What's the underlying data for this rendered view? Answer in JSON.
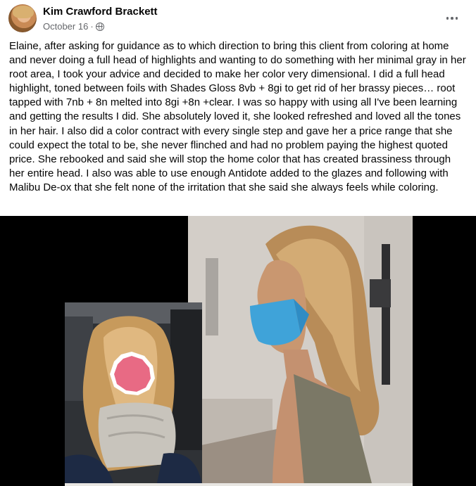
{
  "post": {
    "author": "Kim Crawford Brackett",
    "date": "October 16",
    "separator": "·",
    "privacy_icon": "globe-icon",
    "menu_icon": "more-options-icon",
    "text": "Elaine, after asking for guidance as to which direction to bring this client from coloring at home and never doing a full head of highlights and wanting to do something with her minimal gray in her root area, I took your advice and decided to make her color very dimensional. I did a full head highlight, toned between foils with Shades Gloss 8vb + 8gi to get rid of her brassy pieces… root tapped with 7nb + 8n melted into 8gi +8n +clear. I was so happy with using all I've been learning and getting the results I did. She absolutely loved it, she looked refreshed and loved all the tones in her hair. I also did a color contract with every single step and gave her a price range that she could expect the total to be, she never flinched and had no problem paying the highest quoted price. She rebooked and said she will stop the home color that has created brassiness through her entire head. I also was able to use enough Antidote added to the glazes and following with Malibu De-ox that she felt none of the irritation that she said she always feels while coloring."
  },
  "photo": {
    "left_image": "before-photo-client-in-car-with-blurred-face",
    "right_image": "after-photo-client-profile-with-blue-mask"
  },
  "colors": {
    "text": "#050505",
    "secondary_text": "#65676b",
    "mask_blue": "#3fa3d9",
    "face_blur_pink": "#e86a84"
  }
}
